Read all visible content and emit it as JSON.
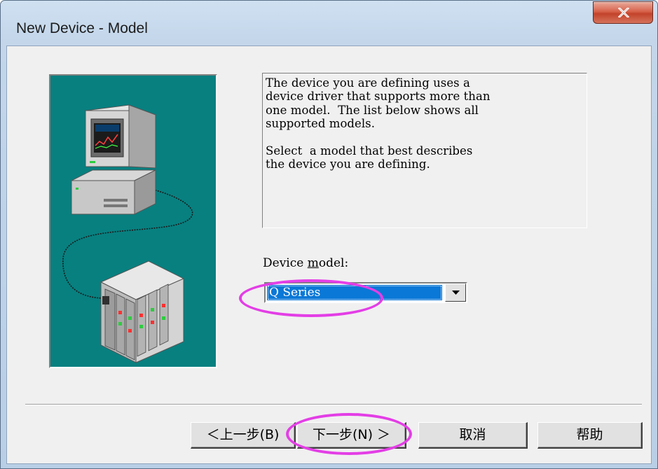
{
  "window": {
    "title": "New Device - Model",
    "close_glyph": "x"
  },
  "description": {
    "text": "The device you are defining uses a\ndevice driver that supports more than\none model.  The list below shows all\nsupported models.\n\nSelect  a model that best describes\nthe device you are defining."
  },
  "model": {
    "label_prefix": "Device ",
    "label_mnemonic": "m",
    "label_suffix": "odel:",
    "selected": "Q Series"
  },
  "buttons": {
    "back_label": "＜上一步(B)",
    "next_label": "下一步(N) ＞",
    "cancel_label": "取消",
    "help_label": "帮助"
  },
  "icons": {
    "close": "close-icon",
    "dropdown": "chevron-down-icon",
    "computer": "computer-icon",
    "plc": "plc-device-icon"
  },
  "colors": {
    "illustration_bg": "#088080",
    "selection": "#0a78d7",
    "annotation": "#e33ee6",
    "close_button": "#c2432a"
  }
}
